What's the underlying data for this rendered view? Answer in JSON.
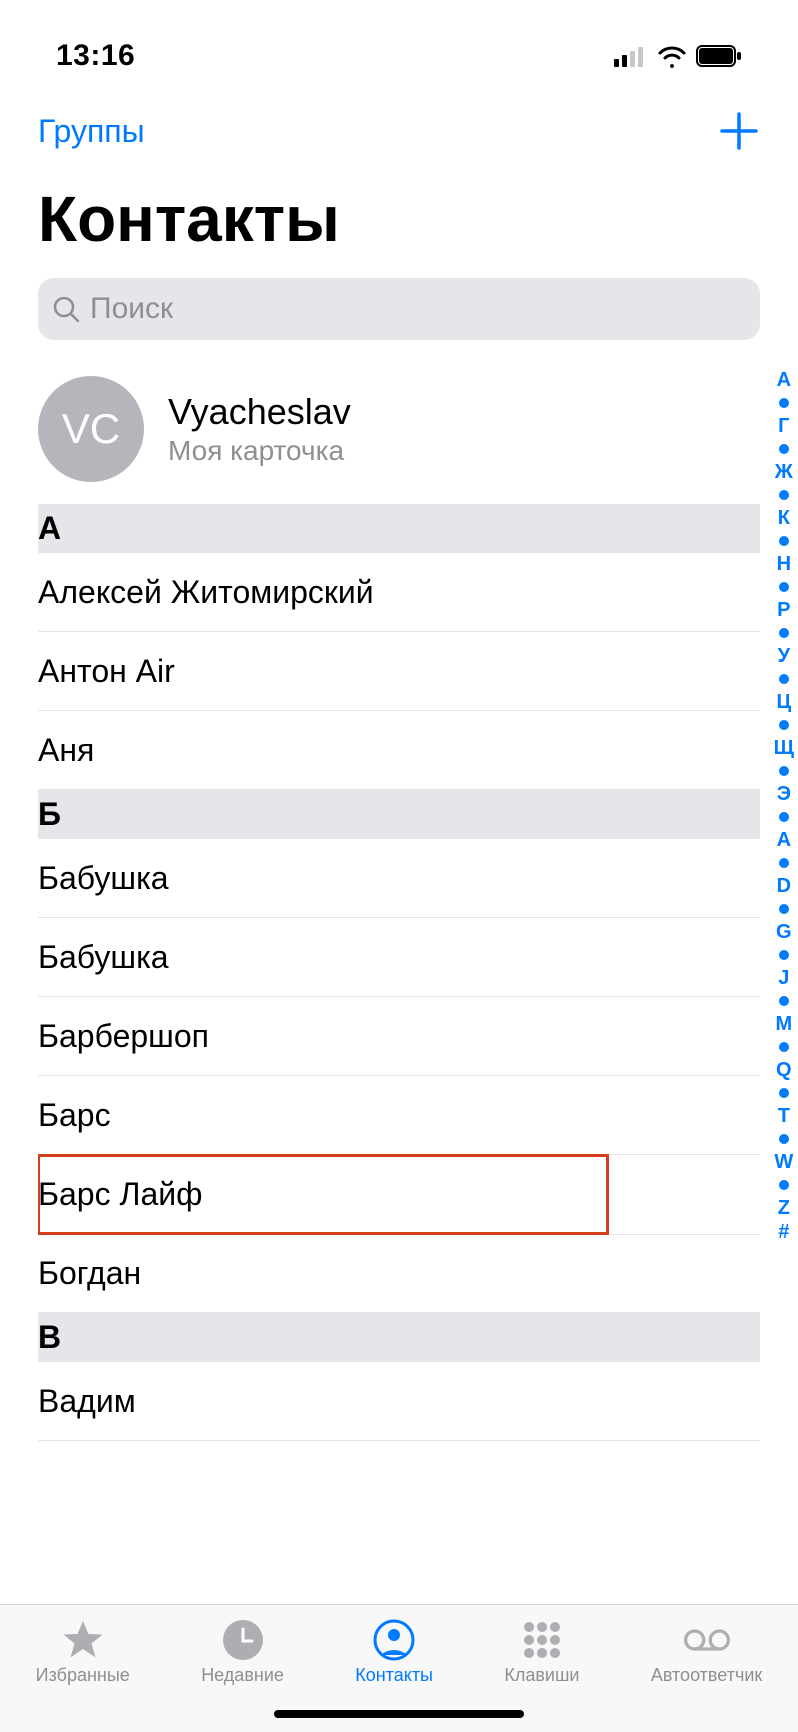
{
  "status": {
    "time": "13:16"
  },
  "nav": {
    "groups_label": "Группы"
  },
  "title": "Контакты",
  "search": {
    "placeholder": "Поиск"
  },
  "me": {
    "initials": "VC",
    "name": "Vyacheslav",
    "subtitle": "Моя карточка"
  },
  "sections": [
    {
      "letter": "А",
      "contacts": [
        "Алексей Житомирский",
        "Антон Air",
        "Аня"
      ]
    },
    {
      "letter": "Б",
      "contacts": [
        "Бабушка",
        "Бабушка",
        "Барбершоп",
        "Барс",
        "Барс Лайф",
        "Богдан"
      ],
      "highlight_index": 4
    },
    {
      "letter": "В",
      "contacts": [
        "Вадим"
      ]
    }
  ],
  "index_strip": [
    "А",
    "•",
    "Г",
    "•",
    "Ж",
    "•",
    "К",
    "•",
    "Н",
    "•",
    "Р",
    "•",
    "У",
    "•",
    "Ц",
    "•",
    "Щ",
    "•",
    "Э",
    "•",
    "A",
    "•",
    "D",
    "•",
    "G",
    "•",
    "J",
    "•",
    "M",
    "•",
    "Q",
    "•",
    "T",
    "•",
    "W",
    "•",
    "Z",
    "#"
  ],
  "tabs": [
    {
      "id": "favorites",
      "label": "Избранные",
      "active": false
    },
    {
      "id": "recents",
      "label": "Недавние",
      "active": false
    },
    {
      "id": "contacts",
      "label": "Контакты",
      "active": true
    },
    {
      "id": "keypad",
      "label": "Клавиши",
      "active": false
    },
    {
      "id": "voicemail",
      "label": "Автоответчик",
      "active": false
    }
  ]
}
